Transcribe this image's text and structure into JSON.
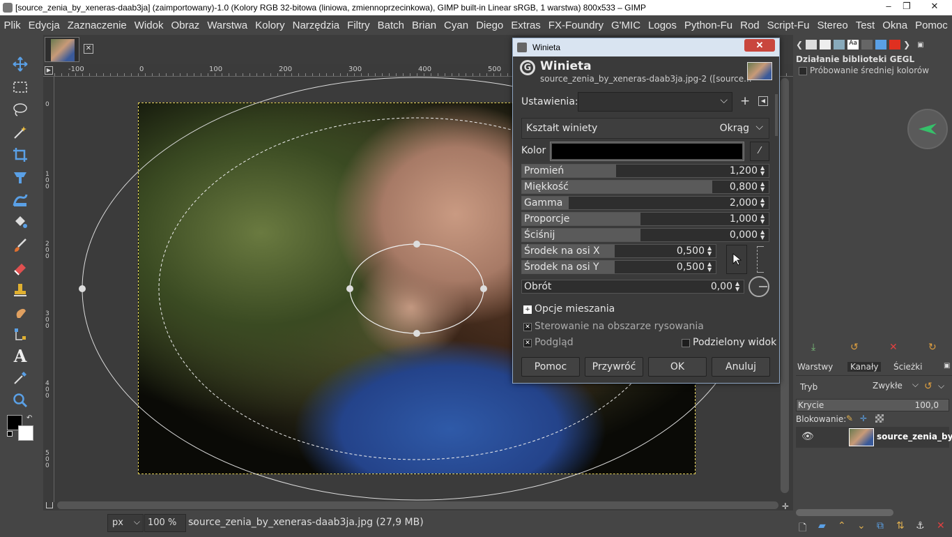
{
  "window": {
    "title": "[source_zenia_by_xeneras-daab3ja] (zaimportowany)-1.0 (Kolory RGB 32-bitowa (liniowa, zmiennoprzecinkowa), GIMP built-in Linear sRGB, 1 warstwa) 800x533 – GIMP",
    "controls": [
      "–",
      "❐",
      "✕"
    ]
  },
  "menubar": [
    "Plik",
    "Edycja",
    "Zaznaczenie",
    "Widok",
    "Obraz",
    "Warstwa",
    "Kolory",
    "Narzędzia",
    "Filtry",
    "Batch",
    "Brian",
    "Cyan",
    "Diego",
    "Extras",
    "FX-Foundry",
    "G'MIC",
    "Logos",
    "Python-Fu",
    "Rod",
    "Script-Fu",
    "Stereo",
    "Test",
    "Okna",
    "Pomoc"
  ],
  "tools": [
    "move-tool-icon",
    "rect-select-icon",
    "lasso-icon",
    "fuzzy-select-icon",
    "crop-icon",
    "transform-icon",
    "warp-icon",
    "bucket-fill-icon",
    "paintbrush-icon",
    "eraser-icon",
    "clone-icon",
    "smudge-icon",
    "paths-icon",
    "text-icon",
    "color-picker-icon",
    "zoom-icon"
  ],
  "ruler": {
    "h_labels": [
      "-100",
      "0",
      "100",
      "200",
      "300",
      "400",
      "500"
    ],
    "v_labels": [
      "0",
      "1\n0\n0",
      "2\n0\n0",
      "3\n0\n0",
      "4\n0\n0",
      "5\n0\n0"
    ]
  },
  "status": {
    "unit": "px",
    "zoom": "100 %",
    "file": "source_zenia_by_xeneras-daab3ja.jpg (27,9 MB)"
  },
  "dialog": {
    "window_title": "Winieta",
    "header_title": "Winieta",
    "header_subtitle": "source_zenia_by_xeneras-daab3ja.jpg-2 ([source...",
    "presets_label": "Ustawienia:",
    "presets_value": "",
    "shape_label": "Kształt winiety",
    "shape_value": "Okrąg",
    "color_label": "Kolor",
    "color_value": "#000000",
    "sliders": [
      {
        "label": "Promień",
        "value": "1,200",
        "fraction": 0.38
      },
      {
        "label": "Miękkość",
        "value": "0,800",
        "fraction": 0.77
      },
      {
        "label": "Gamma",
        "value": "2,000",
        "fraction": 0.19
      },
      {
        "label": "Proporcje",
        "value": "1,000",
        "fraction": 0.48
      },
      {
        "label": "Ściśnij",
        "value": "0,000",
        "fraction": 0.48
      }
    ],
    "center_x_label": "Środek na osi X",
    "center_x_value": "0,500",
    "center_y_label": "Środek na osi Y",
    "center_y_value": "0,500",
    "rotation_label": "Obrót",
    "rotation_value": "0,00",
    "blend_options": "Opcje mieszania",
    "canvas_control": "Sterowanie na obszarze rysowania",
    "preview": "Podgląd",
    "split_view": "Podzielony widok",
    "buttons": {
      "help": "Pomoc",
      "reset": "Przywróć",
      "ok": "OK",
      "cancel": "Anuluj"
    }
  },
  "right_dock": {
    "gegl_title": "Działanie biblioteki GEGL",
    "gegl_item": "Próbowanie średniej kolorów",
    "tabs": [
      "Warstwy",
      "Kanały",
      "Ścieżki"
    ],
    "mode_label": "Tryb",
    "mode_value": "Zwykłe",
    "opacity_label": "Krycie",
    "opacity_value": "100,0",
    "lock_label": "Blokowanie:",
    "layer_name": "source_zenia_by_"
  },
  "colors": {
    "accent_ok": "#1f6fbf",
    "fg_color": "#000000",
    "bg_color": "#ffffff"
  }
}
